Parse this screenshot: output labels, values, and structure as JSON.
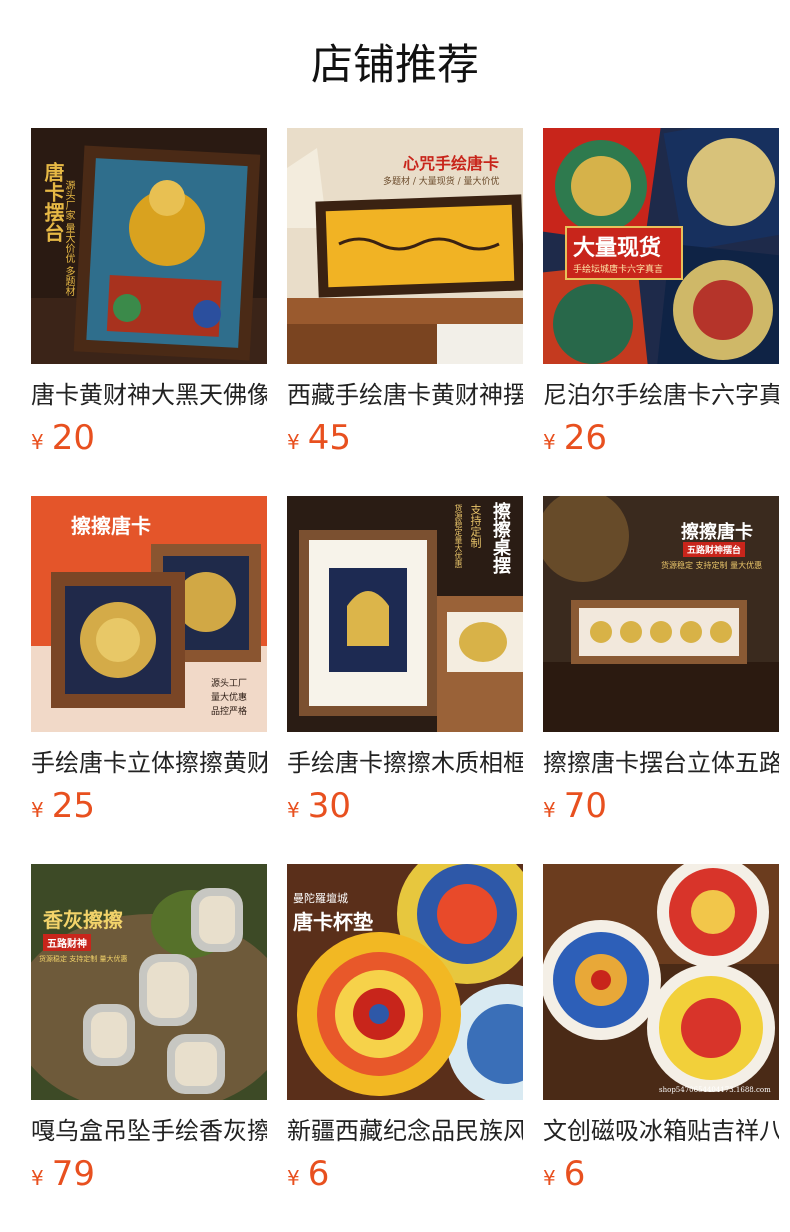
{
  "section": {
    "title": "店铺推荐"
  },
  "currency_symbol": "¥",
  "products": [
    {
      "name": "唐卡黄财神大黑天佛像",
      "price": "20",
      "img_text": {
        "main": "唐卡摆台",
        "sub": "源头厂家 量大价优 多题材"
      }
    },
    {
      "name": "西藏手绘唐卡黄财神摆台",
      "price": "45",
      "img_text": {
        "main": "心咒手绘唐卡",
        "sub": "多题材 / 大量现货 / 量大价优"
      }
    },
    {
      "name": "尼泊尔手绘唐卡六字真言",
      "price": "26",
      "img_text": {
        "main": "大量现货",
        "sub": "手绘坛城唐卡六字真言"
      }
    },
    {
      "name": "手绘唐卡立体擦擦黄财神",
      "price": "25",
      "img_text": {
        "main": "擦擦唐卡",
        "sub1": "源头工厂",
        "sub2": "量大优惠",
        "sub3": "品控严格"
      }
    },
    {
      "name": "手绘唐卡擦擦木质相框摆件",
      "price": "30",
      "img_text": {
        "main": "擦擦桌摆",
        "sub": "支持定制",
        "sub2": "货源稳定量大优惠"
      }
    },
    {
      "name": "擦擦唐卡摆台立体五路财神",
      "price": "70",
      "img_text": {
        "main": "擦擦唐卡",
        "sub": "五路财神摆台",
        "sub2": "货源稳定 支持定制 量大优惠"
      }
    },
    {
      "name": "嘎乌盒吊坠手绘香灰擦擦",
      "price": "79",
      "img_text": {
        "main": "香灰擦擦",
        "sub": "五路财神",
        "sub2": "货源稳定 支持定制 量大优惠"
      }
    },
    {
      "name": "新疆西藏纪念品民族风杯垫",
      "price": "6",
      "img_text": {
        "main": "唐卡杯垫",
        "sub": "曼陀羅壇城"
      }
    },
    {
      "name": "文创磁吸冰箱贴吉祥八宝",
      "price": "6",
      "img_text": {
        "watermark": "shop5470654404173.1688.com"
      }
    }
  ],
  "colors": {
    "price": "#e8501f",
    "accent_red": "#c8251b",
    "wood": "#6b3f22",
    "gold": "#e0b23a"
  }
}
